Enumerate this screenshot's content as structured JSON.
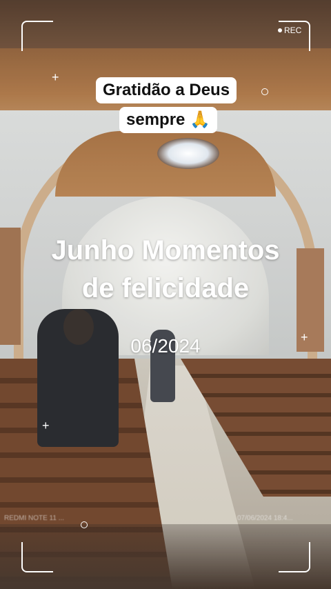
{
  "recording": {
    "label": "REC"
  },
  "caption": {
    "line1": "Gratidão a Deus",
    "line2": "sempre 🙏"
  },
  "title": {
    "line1": "Junho Momentos",
    "line2": "de felicidade"
  },
  "date": "06/2024",
  "watermark": {
    "left": "REDMI NOTE 11 ...",
    "right": "07/06/2024 18:4..."
  },
  "icons": [
    "rec-dot-icon",
    "plus-icon",
    "ring-icon",
    "frame-corner-icon"
  ]
}
